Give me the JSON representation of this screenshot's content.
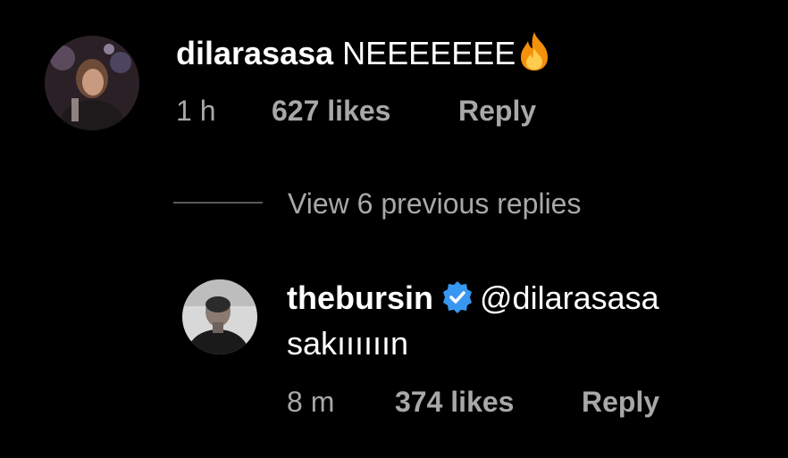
{
  "comment": {
    "username": "dilarasasa",
    "text": "NEEEEEEE",
    "emoji": "fire-icon",
    "time": "1 h",
    "likes": "627 likes",
    "reply_label": "Reply"
  },
  "view_replies": {
    "label": "View 6 previous replies"
  },
  "reply": {
    "username": "thebursin",
    "verified": true,
    "mention": "@dilarasasa",
    "text": "sakıııııın",
    "time": "8 m",
    "likes": "374 likes",
    "reply_label": "Reply"
  },
  "colors": {
    "background": "#000000",
    "primary_text": "#ffffff",
    "secondary_text": "#a8a8a8",
    "verified_badge": "#3897f0",
    "divider": "#5a5a5a"
  }
}
